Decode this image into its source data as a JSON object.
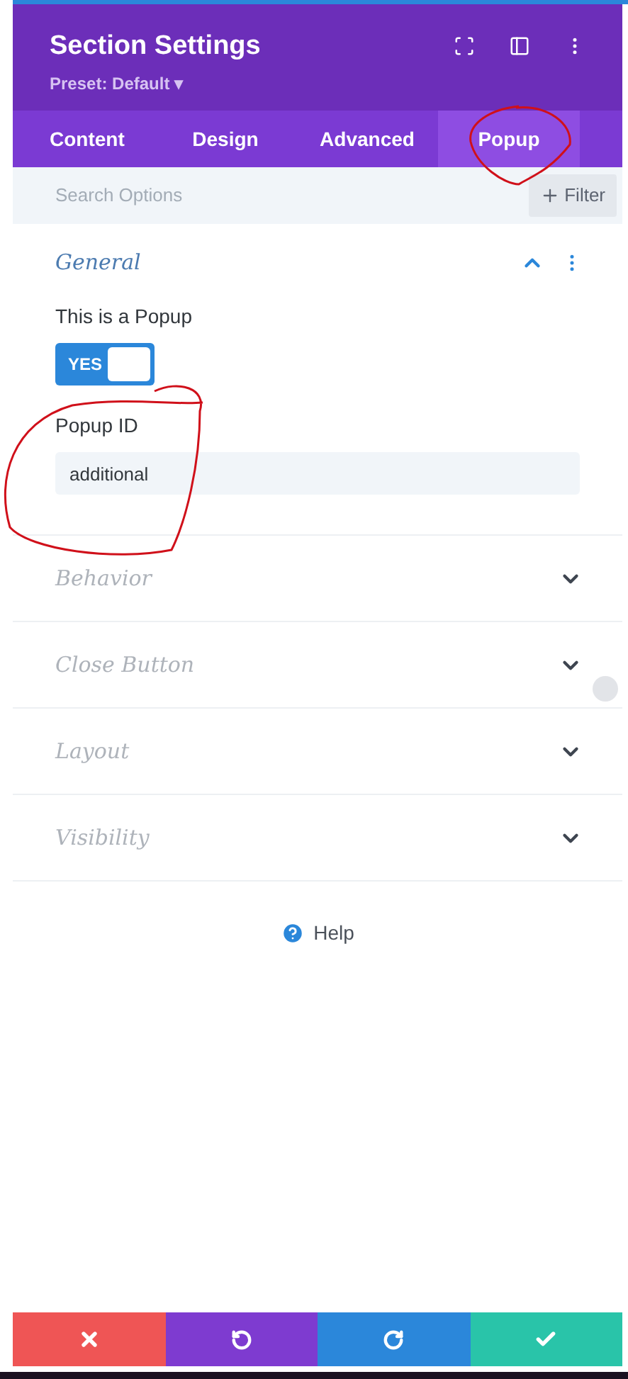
{
  "header": {
    "title": "Section Settings",
    "preset": "Preset: Default ▾"
  },
  "tabs": [
    {
      "label": "Content",
      "selected": false
    },
    {
      "label": "Design",
      "selected": false
    },
    {
      "label": "Advanced",
      "selected": false
    },
    {
      "label": "Popup",
      "selected": true
    }
  ],
  "search": {
    "placeholder": "Search Options",
    "filter": "Filter"
  },
  "groups": [
    {
      "title": "General",
      "expanded": true,
      "fields": [
        {
          "kind": "toggle",
          "label": "This is a Popup",
          "on": true,
          "on_text": "YES"
        },
        {
          "kind": "text",
          "label": "Popup ID",
          "value": "additional"
        }
      ]
    },
    {
      "title": "Behavior",
      "expanded": false
    },
    {
      "title": "Close Button",
      "expanded": false
    },
    {
      "title": "Layout",
      "expanded": false
    },
    {
      "title": "Visibility",
      "expanded": false
    }
  ],
  "help": "Help"
}
